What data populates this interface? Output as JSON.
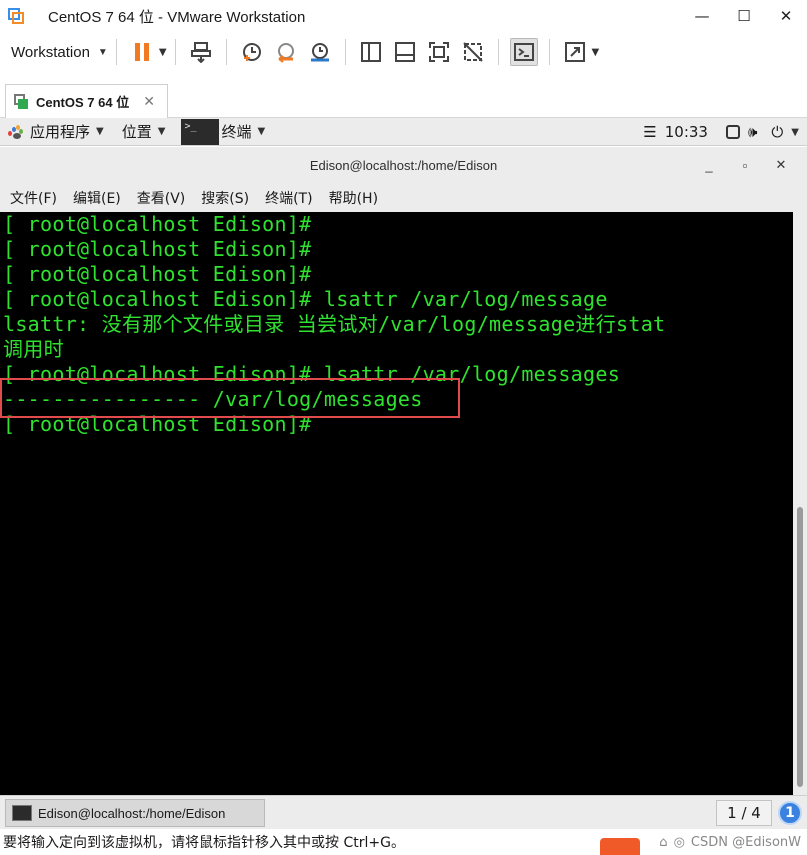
{
  "window": {
    "title": "CentOS 7 64 位 - VMware Workstation",
    "minimize": "—",
    "maximize": "☐",
    "close": "✕"
  },
  "toolbar": {
    "workstation_label": "Workstation"
  },
  "tab": {
    "label": "CentOS 7 64 位",
    "close": "✕"
  },
  "gnome_panel": {
    "applications": "应用程序",
    "places": "位置",
    "terminal": "终端",
    "time": "10:33",
    "term_icon_text": ">_"
  },
  "terminal": {
    "title": "Edison@localhost:/home/Edison",
    "menu": [
      "文件(F)",
      "编辑(E)",
      "查看(V)",
      "搜索(S)",
      "终端(T)",
      "帮助(H)"
    ],
    "lines": [
      "[ root@localhost Edison]#",
      "[ root@localhost Edison]#",
      "[ root@localhost Edison]#",
      "[ root@localhost Edison]# lsattr /var/log/message",
      "lsattr: 没有那个文件或目录 当尝试对/var/log/message进行stat",
      "调用时",
      "[ root@localhost Edison]# lsattr /var/log/messages",
      "---------------- /var/log/messages",
      "[ root@localhost Edison]#"
    ]
  },
  "bottom_bar": {
    "task_label": "Edison@localhost:/home/Edison",
    "workspace": "1 / 4",
    "info": "1"
  },
  "status": {
    "message": "要将输入定向到该虚拟机，请将鼠标指针移入其中或按 Ctrl+G。",
    "watermark": "CSDN @EdisonW"
  }
}
